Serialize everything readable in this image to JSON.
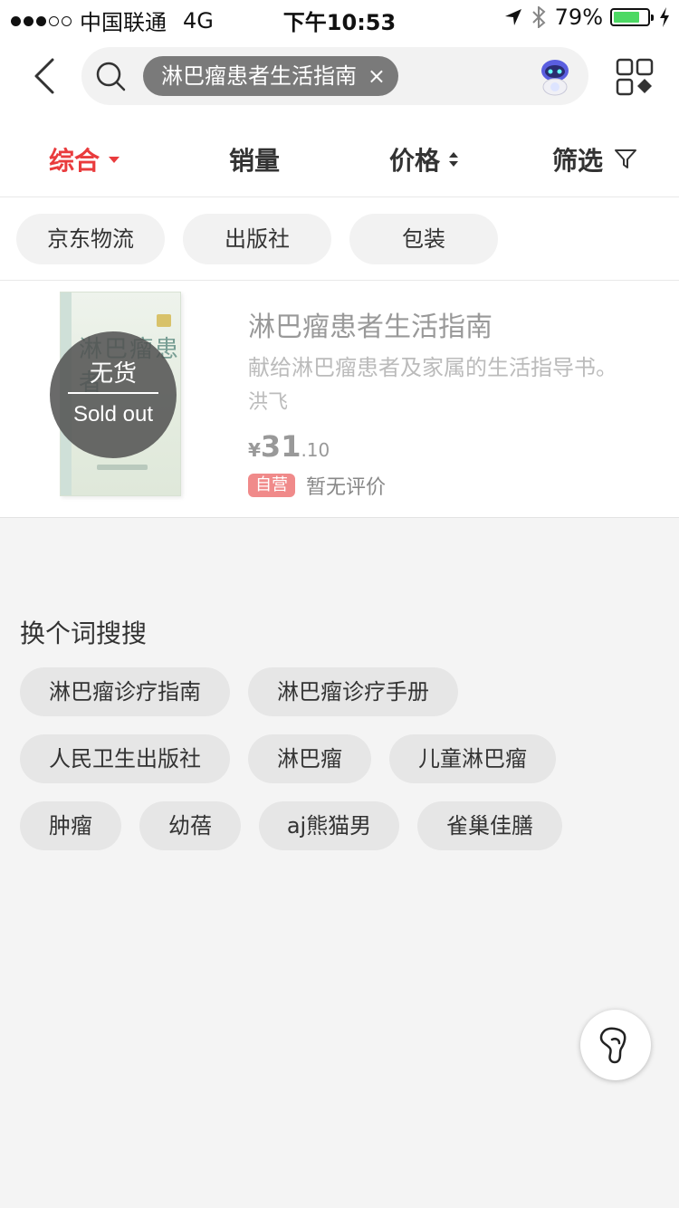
{
  "status_bar": {
    "carrier": "中国联通",
    "network": "4G",
    "time": "下午10:53",
    "battery": "79%",
    "battery_level": 0.79
  },
  "search": {
    "tag": "淋巴瘤患者生活指南",
    "tag_close": "×"
  },
  "sort": {
    "items": [
      "综合",
      "销量",
      "价格",
      "筛选"
    ]
  },
  "filters": [
    "京东物流",
    "出版社",
    "包装"
  ],
  "product": {
    "soldout_cn": "无货",
    "soldout_en": "Sold out",
    "title": "淋巴瘤患者生活指南",
    "description": "献给淋巴瘤患者及家属的生活指导书。",
    "author": "洪飞",
    "price_symbol": "¥",
    "price_int": "31",
    "price_dec": ".10",
    "self_run": "自营",
    "review": "暂无评价",
    "cover_title": "淋巴瘤患者"
  },
  "suggestions": {
    "title": "换个词搜搜",
    "items": [
      "淋巴瘤诊疗指南",
      "淋巴瘤诊疗手册",
      "人民卫生出版社",
      "淋巴瘤",
      "儿童淋巴瘤",
      "肿瘤",
      "幼蓓",
      "aj熊猫男",
      "雀巢佳膳"
    ]
  }
}
